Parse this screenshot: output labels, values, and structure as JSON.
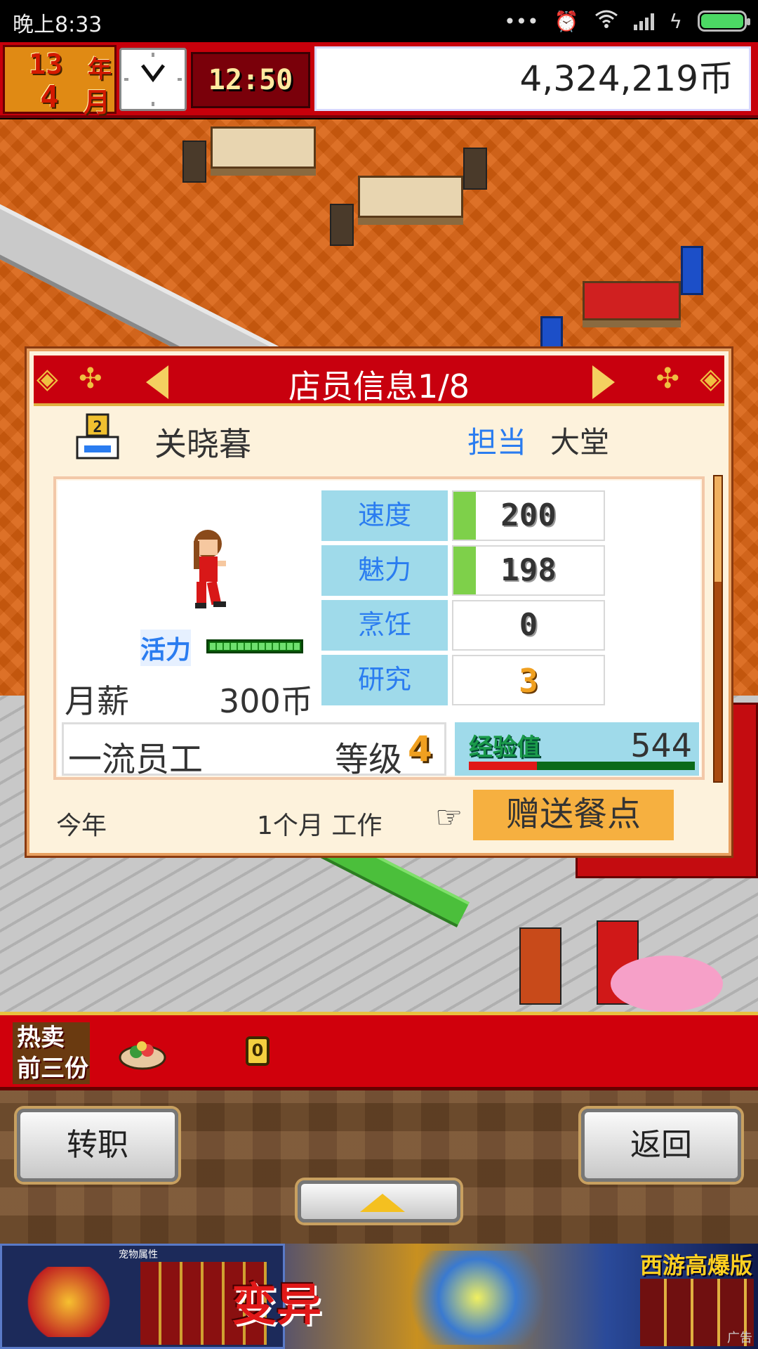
{
  "statusbar": {
    "time": "晚上8:33",
    "icons": [
      "more-icon",
      "alarm-icon",
      "wifi-icon",
      "signal-icon",
      "charging-icon",
      "battery-icon"
    ]
  },
  "top": {
    "year": "13",
    "year_unit": "年",
    "month": "4",
    "month_unit": "月",
    "clock_time": "12:50",
    "money": "4,324,219币"
  },
  "panel": {
    "title": "店员信息1/8",
    "rank_badge": "2",
    "name": "关晓暮",
    "role_label": "担当",
    "role_value": "大堂",
    "vitality_label": "活力",
    "vitality_level": 1.0,
    "salary_label": "月薪",
    "salary_value": "300币",
    "stats": [
      {
        "label": "速度",
        "value": "200",
        "bar_fraction": 0.15
      },
      {
        "label": "魅力",
        "value": "198",
        "bar_fraction": 0.15
      },
      {
        "label": "烹饪",
        "value": "0",
        "bar_fraction": 0
      },
      {
        "label": "研究",
        "value": "3",
        "bar_fraction": 0
      }
    ],
    "rank_title": "一流员工",
    "level_label": "等级",
    "level_value": "4",
    "exp_label": "经验值",
    "exp_value": "544",
    "exp_fraction": 0.3,
    "footer_year": "今年",
    "footer_work": "1个月 工作",
    "gift_button": "赠送餐点"
  },
  "hotbar": {
    "label_line1": "热卖",
    "label_line2": "前三份",
    "count": "0"
  },
  "controls": {
    "job_button": "转职",
    "back_button": "返回"
  },
  "ad": {
    "panel_title": "宠物属性",
    "headline": "变异",
    "game_title": "西游高爆版",
    "tag": "广告"
  },
  "colors": {
    "header_red": "#c8000e",
    "stat_blue": "#9fdaea",
    "link_blue": "#2a7cf0",
    "gift_orange": "#f6b040"
  }
}
